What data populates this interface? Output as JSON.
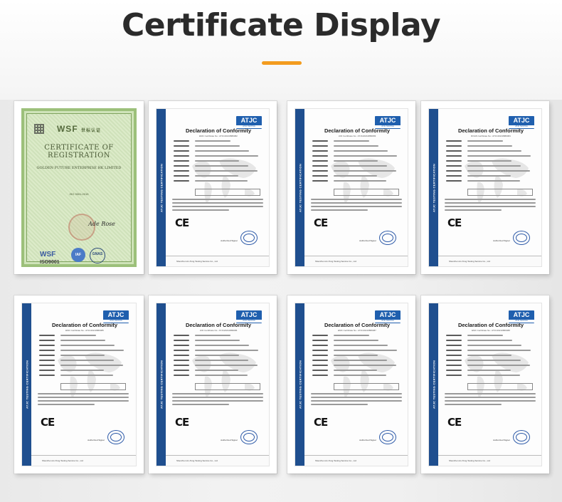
{
  "header": {
    "title": "Certificate Display",
    "accent_color": "#f39c1f"
  },
  "wsf_certificate": {
    "logo": "WSF",
    "logo_sub": "世标认证",
    "title": "CERTIFICATE OF REGISTRATION",
    "company": "GOLDEN FUTURE ENTERPRISE HK LIMITED",
    "standard": "ISO 9001:2015",
    "signature": "Ade Rose",
    "bottom_logo": "WSF",
    "iso_label": "ISO9001",
    "badge_iaf": "IAF",
    "badge_gnas": "GNAS"
  },
  "atjc_certificates": [
    {
      "logo": "ATJC",
      "title": "Declaration of Conformity",
      "cert_no": "EMC Certificate No.: ATJC20210880082",
      "ce_mark": "CE",
      "signer": "Authorized Signer",
      "strip_text": "ATJC TESTING CERTIFICATION"
    },
    {
      "logo": "ATJC",
      "title": "Declaration of Conformity",
      "cert_no": "LVD Certificate No.: ATJC20210880083",
      "ce_mark": "CE",
      "signer": "Authorized Signer",
      "strip_text": "ATJC TESTING CERTIFICATION"
    },
    {
      "logo": "ATJC",
      "title": "Declaration of Conformity",
      "cert_no": "ROHS Certificate No.: ATJC20210880084",
      "ce_mark": "CE",
      "signer": "Authorized Signer",
      "strip_text": "ATJC TESTING CERTIFICATION"
    },
    {
      "logo": "ATJC",
      "title": "Declaration of Conformity",
      "cert_no": "EMC Certificate No.: ATJC20210880085",
      "ce_mark": "CE",
      "signer": "Authorized Signer",
      "strip_text": "ATJC TESTING CERTIFICATION"
    },
    {
      "logo": "ATJC",
      "title": "Declaration of Conformity",
      "cert_no": "LVD Certificate No.: ATJC20210880086",
      "ce_mark": "CE",
      "signer": "Authorized Signer",
      "strip_text": "ATJC TESTING CERTIFICATION"
    },
    {
      "logo": "ATJC",
      "title": "Declaration of Conformity",
      "cert_no": "EMC Certificate No.: ATJC20210880087",
      "ce_mark": "CE",
      "signer": "Authorized Signer",
      "strip_text": "ATJC TESTING CERTIFICATION"
    },
    {
      "logo": "ATJC",
      "title": "Declaration of Conformity",
      "cert_no": "EMC Certificate No.: ATJC20210880088",
      "ce_mark": "CE",
      "signer": "Authorized Signer",
      "strip_text": "ATJC TESTING CERTIFICATION"
    }
  ],
  "footer_company": "Shenzhen An-Tong Testing Service Co., Ltd"
}
